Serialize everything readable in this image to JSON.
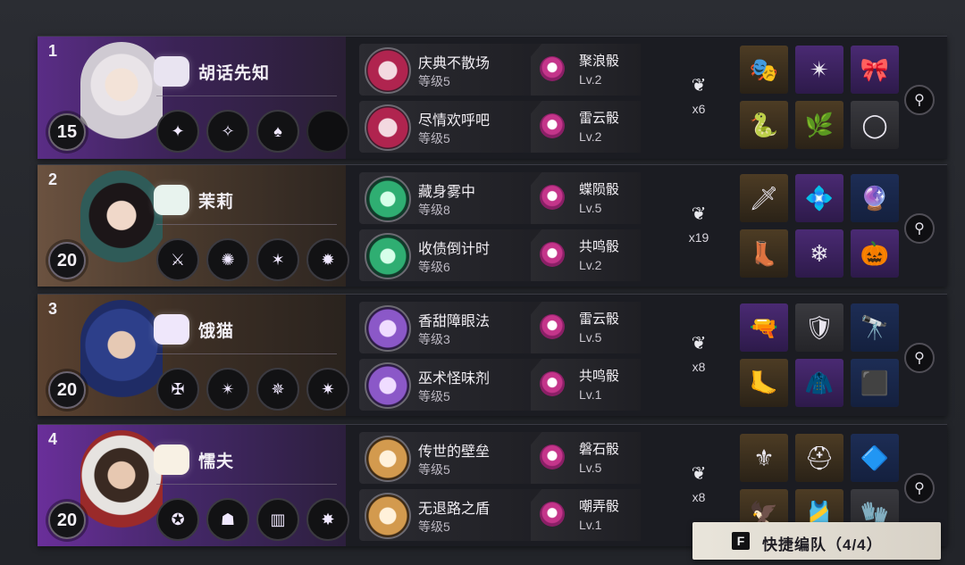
{
  "quick_team": {
    "key": "F",
    "label": "快捷编队（4/4）"
  },
  "rows": [
    {
      "index": "1",
      "level": "15",
      "name": "胡话先知",
      "traits": [
        {
          "name": "庆典不散场",
          "level": "等级5"
        },
        {
          "name": "尽情欢呼吧",
          "level": "等级5"
        }
      ],
      "dice": [
        {
          "name": "聚浪骰",
          "level": "Lv.2"
        },
        {
          "name": "雷云骰",
          "level": "Lv.2"
        }
      ],
      "multiplier": "x6"
    },
    {
      "index": "2",
      "level": "20",
      "name": "茉莉",
      "traits": [
        {
          "name": "藏身雾中",
          "level": "等级8"
        },
        {
          "name": "收债倒计时",
          "level": "等级6"
        }
      ],
      "dice": [
        {
          "name": "蝶陨骰",
          "level": "Lv.5"
        },
        {
          "name": "共鸣骰",
          "level": "Lv.2"
        }
      ],
      "multiplier": "x19"
    },
    {
      "index": "3",
      "level": "20",
      "name": "饿猫",
      "traits": [
        {
          "name": "香甜障眼法",
          "level": "等级3"
        },
        {
          "name": "巫术怪味剂",
          "level": "等级5"
        }
      ],
      "dice": [
        {
          "name": "雷云骰",
          "level": "Lv.5"
        },
        {
          "name": "共鸣骰",
          "level": "Lv.1"
        }
      ],
      "multiplier": "x8"
    },
    {
      "index": "4",
      "level": "20",
      "name": "懦夫",
      "traits": [
        {
          "name": "传世的壁垒",
          "level": "等级5"
        },
        {
          "name": "无退路之盾",
          "level": "等级5"
        }
      ],
      "dice": [
        {
          "name": "磐石骰",
          "level": "Lv.5"
        },
        {
          "name": "嘲弄骰",
          "level": "Lv.1"
        }
      ],
      "multiplier": "x8"
    }
  ]
}
